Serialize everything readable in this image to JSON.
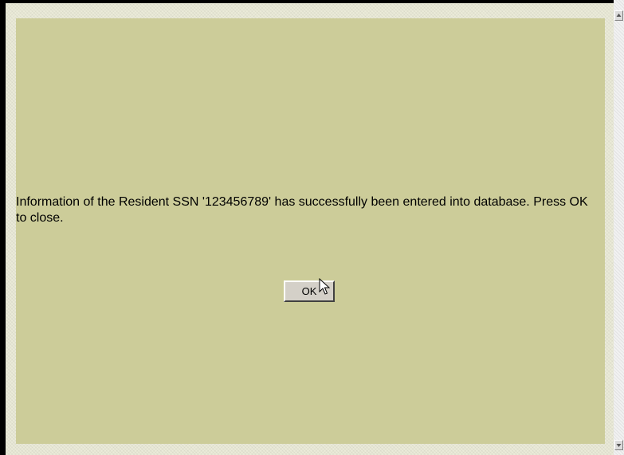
{
  "dialog": {
    "message": "Information of the Resident SSN '123456789' has successfully been entered into database. Press OK to close.",
    "ok_label": "OK"
  },
  "icons": {
    "cursor": "mouse-pointer-icon",
    "scroll_up": "scroll-up-arrow-icon",
    "scroll_down": "scroll-down-arrow-icon"
  },
  "colors": {
    "panel_background": "#cccc99",
    "page_background": "#ebebd9",
    "button_face": "#d4d0c8"
  }
}
